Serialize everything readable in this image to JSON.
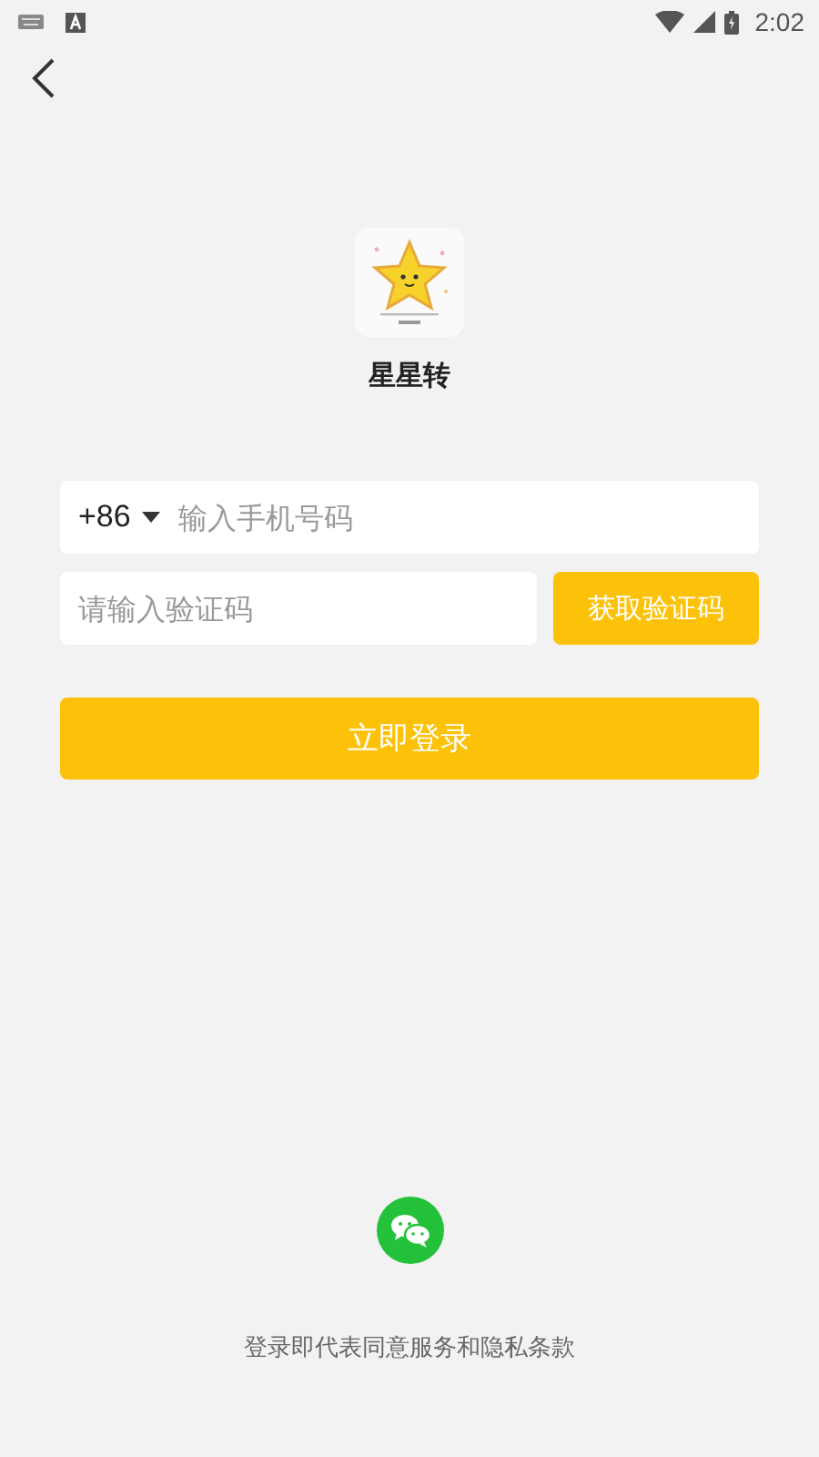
{
  "status_bar": {
    "time": "2:02"
  },
  "app": {
    "name": "星星转"
  },
  "phone": {
    "country_code": "+86",
    "placeholder": "输入手机号码"
  },
  "code": {
    "placeholder": "请输入验证码",
    "button": "获取验证码"
  },
  "login_button": "立即登录",
  "terms": "登录即代表同意服务和隐私条款"
}
